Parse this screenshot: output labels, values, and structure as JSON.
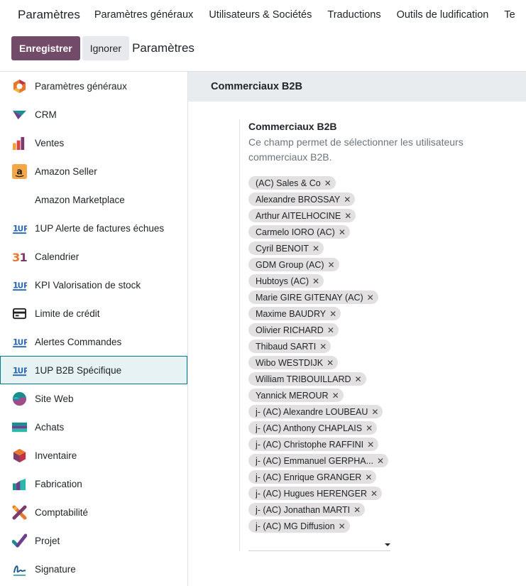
{
  "navbar": {
    "app_name": "Paramètres",
    "menu": [
      "Paramètres généraux",
      "Utilisateurs & Sociétés",
      "Traductions",
      "Outils de ludification",
      "Te"
    ]
  },
  "control_panel": {
    "save_label": "Enregistrer",
    "discard_label": "Ignorer",
    "breadcrumb": "Paramètres"
  },
  "sidebar": {
    "items": [
      {
        "label": "Paramètres généraux",
        "icon": "settings-hex-icon"
      },
      {
        "label": "CRM",
        "icon": "crm-icon"
      },
      {
        "label": "Ventes",
        "icon": "sales-chart-icon"
      },
      {
        "label": "Amazon Seller",
        "icon": "amazon-icon"
      },
      {
        "label": "Amazon Marketplace",
        "icon": ""
      },
      {
        "label": "1UP Alerte de factures échues",
        "icon": "1up-icon"
      },
      {
        "label": "Calendrier",
        "icon": "calendar-31-icon"
      },
      {
        "label": "KPI Valorisation de stock",
        "icon": "1up-icon"
      },
      {
        "label": "Limite de crédit",
        "icon": "credit-card-icon"
      },
      {
        "label": "Alertes Commandes",
        "icon": "1up-icon"
      },
      {
        "label": "1UP B2B Spécifique",
        "icon": "1up-icon"
      },
      {
        "label": "Site Web",
        "icon": "website-icon"
      },
      {
        "label": "Achats",
        "icon": "purchase-icon"
      },
      {
        "label": "Inventaire",
        "icon": "inventory-icon"
      },
      {
        "label": "Fabrication",
        "icon": "manufacturing-icon"
      },
      {
        "label": "Comptabilité",
        "icon": "accounting-icon"
      },
      {
        "label": "Projet",
        "icon": "project-check-icon"
      },
      {
        "label": "Signature",
        "icon": "signature-icon"
      }
    ],
    "active_index": 10
  },
  "main": {
    "section_title": "Commerciaux B2B",
    "setting": {
      "title": "Commerciaux B2B",
      "description": "Ce champ permet de sélectionner les utilisateurs commerciaux B2B.",
      "tags": [
        "(AC) Sales & Co",
        "Alexandre BROSSAY",
        "Arthur AITELHOCINE",
        "Carmelo IORO (AC)",
        "Cyril BENOIT",
        "GDM Group (AC)",
        "Hubtoys (AC)",
        "Marie GIRE GITENAY (AC)",
        "Maxime BAUDRY",
        "Olivier RICHARD",
        "Thibaud SARTI",
        "Wibo WESTDIJK",
        "William TRIBOUILLARD",
        "Yannick MEROUR",
        "j- (AC) Alexandre LOUBEAU",
        "j- (AC) Anthony CHAPLAIS",
        "j- (AC) Christophe RAFFINI",
        "j- (AC) Emmanuel GERPHA...",
        "j- (AC) Enrique GRANGER",
        "j- (AC) Hugues HERENGER",
        "j- (AC) Jonathan MARTI",
        "j- (AC) MG Diffusion"
      ],
      "remove_glyph": "✕"
    }
  },
  "colors": {
    "primary": "#714b67",
    "active_border": "#017e84",
    "tag_bg": "#e2e0e0",
    "section_bg": "#e9ecef"
  }
}
